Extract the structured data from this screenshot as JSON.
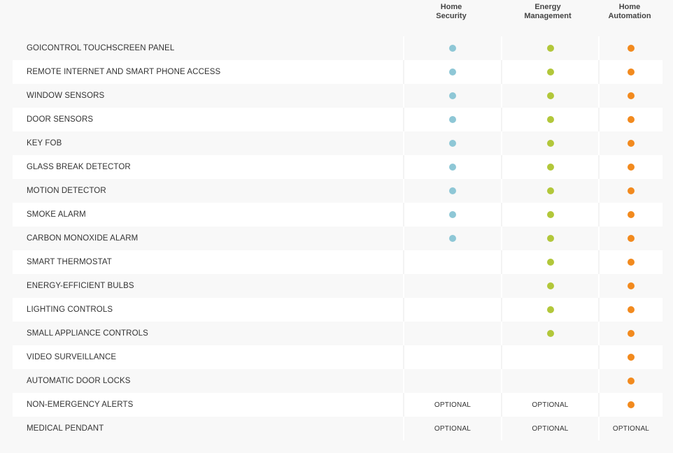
{
  "columns": [
    {
      "line1": "Home",
      "line2": "Security"
    },
    {
      "line1": "Energy",
      "line2": "Management"
    },
    {
      "line1": "Home",
      "line2": "Automation"
    }
  ],
  "colors": {
    "security": "#8ec7d6",
    "energy": "#b2c73a",
    "automation": "#f28a1e"
  },
  "optional_label": "OPTIONAL",
  "rows": [
    {
      "feature": "GOICONTROL TOUCHSCREEN PANEL",
      "security": "dot",
      "energy": "dot",
      "automation": "dot"
    },
    {
      "feature": "REMOTE INTERNET AND SMART PHONE ACCESS",
      "security": "dot",
      "energy": "dot",
      "automation": "dot"
    },
    {
      "feature": "WINDOW SENSORS",
      "security": "dot",
      "energy": "dot",
      "automation": "dot"
    },
    {
      "feature": "DOOR SENSORS",
      "security": "dot",
      "energy": "dot",
      "automation": "dot"
    },
    {
      "feature": "KEY FOB",
      "security": "dot",
      "energy": "dot",
      "automation": "dot"
    },
    {
      "feature": "GLASS BREAK DETECTOR",
      "security": "dot",
      "energy": "dot",
      "automation": "dot"
    },
    {
      "feature": "MOTION DETECTOR",
      "security": "dot",
      "energy": "dot",
      "automation": "dot"
    },
    {
      "feature": "SMOKE ALARM",
      "security": "dot",
      "energy": "dot",
      "automation": "dot"
    },
    {
      "feature": "CARBON MONOXIDE ALARM",
      "security": "dot",
      "energy": "dot",
      "automation": "dot"
    },
    {
      "feature": "SMART THERMOSTAT",
      "security": "",
      "energy": "dot",
      "automation": "dot"
    },
    {
      "feature": "ENERGY-EFFICIENT BULBS",
      "security": "",
      "energy": "dot",
      "automation": "dot"
    },
    {
      "feature": "LIGHTING CONTROLS",
      "security": "",
      "energy": "dot",
      "automation": "dot"
    },
    {
      "feature": "SMALL APPLIANCE CONTROLS",
      "security": "",
      "energy": "dot",
      "automation": "dot"
    },
    {
      "feature": "VIDEO SURVEILLANCE",
      "security": "",
      "energy": "",
      "automation": "dot"
    },
    {
      "feature": "AUTOMATIC DOOR LOCKS",
      "security": "",
      "energy": "",
      "automation": "dot"
    },
    {
      "feature": "NON-EMERGENCY ALERTS",
      "security": "optional",
      "energy": "optional",
      "automation": "dot"
    },
    {
      "feature": "MEDICAL PENDANT",
      "security": "optional",
      "energy": "optional",
      "automation": "optional"
    }
  ]
}
